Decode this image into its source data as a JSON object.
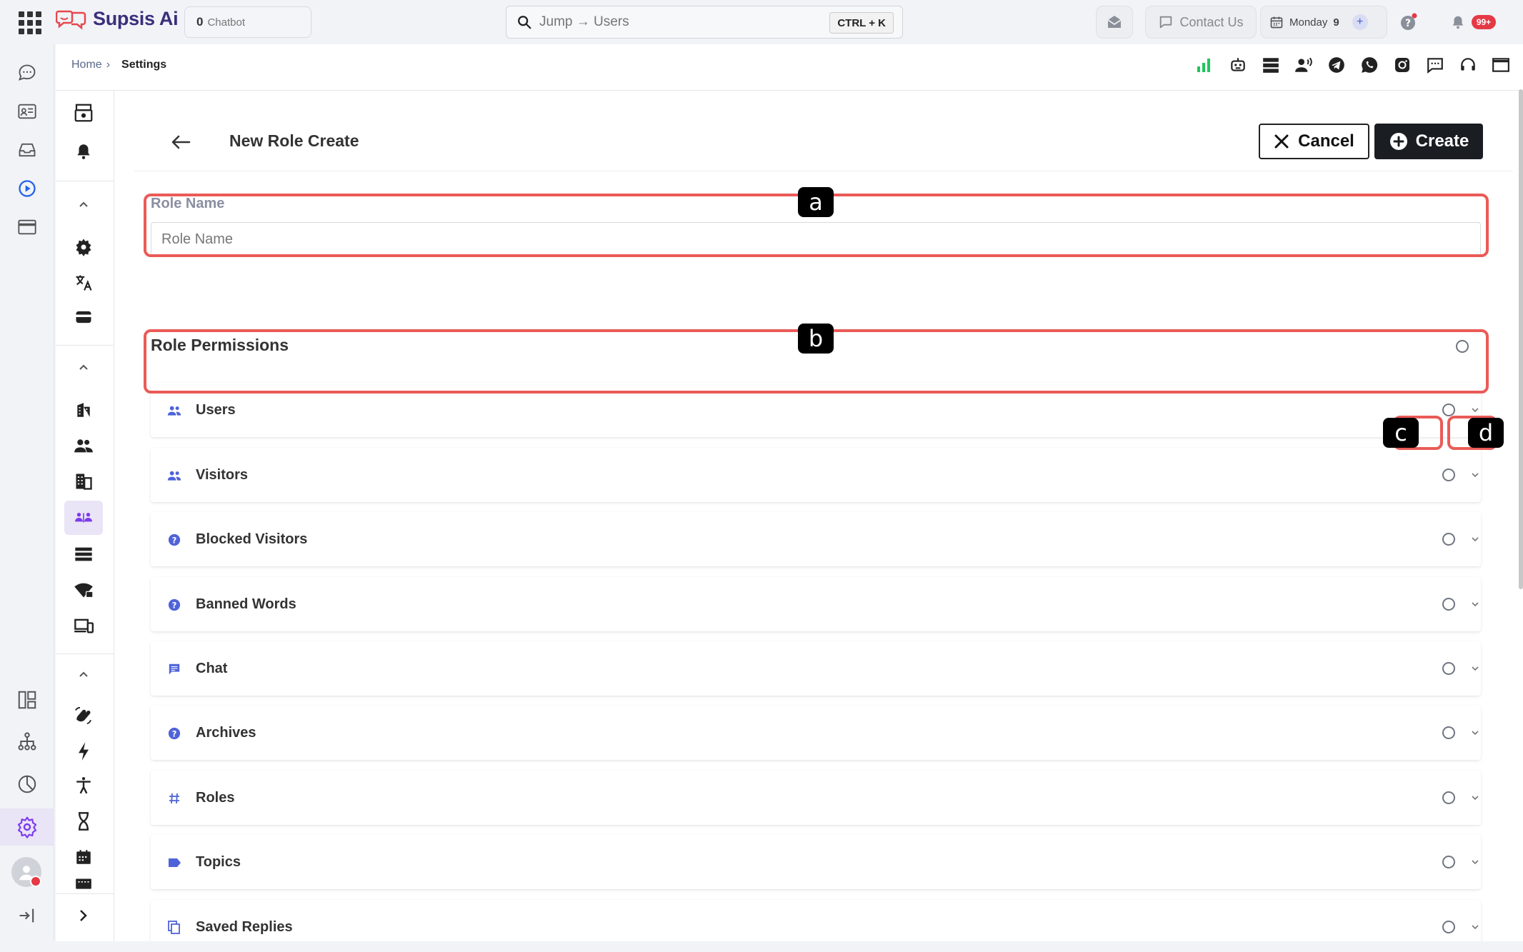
{
  "app": {
    "name": "Supsis Ai",
    "brand_color": "#3b2f7a",
    "accent": "#ea5b57"
  },
  "topbar": {
    "chatbot_count": "0",
    "chatbot_label": "Chatbot",
    "search_placeholder": "Jump → Users",
    "search_shortcut": "CTRL + K",
    "contact_label": "Contact Us",
    "day_label": "Monday",
    "day_number": "9",
    "notification_count": "99+"
  },
  "breadcrumb": {
    "home": "Home",
    "separator": "›",
    "current": "Settings"
  },
  "page": {
    "title": "New Role Create",
    "cancel_label": "Cancel",
    "create_label": "Create"
  },
  "form": {
    "role_name_label": "Role Name",
    "role_name_placeholder": "Role Name",
    "role_name_value": ""
  },
  "permissions": {
    "title": "Role Permissions",
    "items": [
      {
        "label": "Users",
        "icon": "group-icon"
      },
      {
        "label": "Visitors",
        "icon": "group-icon"
      },
      {
        "label": "Blocked Visitors",
        "icon": "help-icon"
      },
      {
        "label": "Banned Words",
        "icon": "help-icon"
      },
      {
        "label": "Chat",
        "icon": "chat-icon"
      },
      {
        "label": "Archives",
        "icon": "help-icon"
      },
      {
        "label": "Roles",
        "icon": "hash-icon"
      },
      {
        "label": "Topics",
        "icon": "label-icon"
      },
      {
        "label": "Saved Replies",
        "icon": "copy-icon"
      }
    ]
  },
  "annotations": {
    "a": "a",
    "b": "b",
    "c": "c",
    "d": "d"
  }
}
